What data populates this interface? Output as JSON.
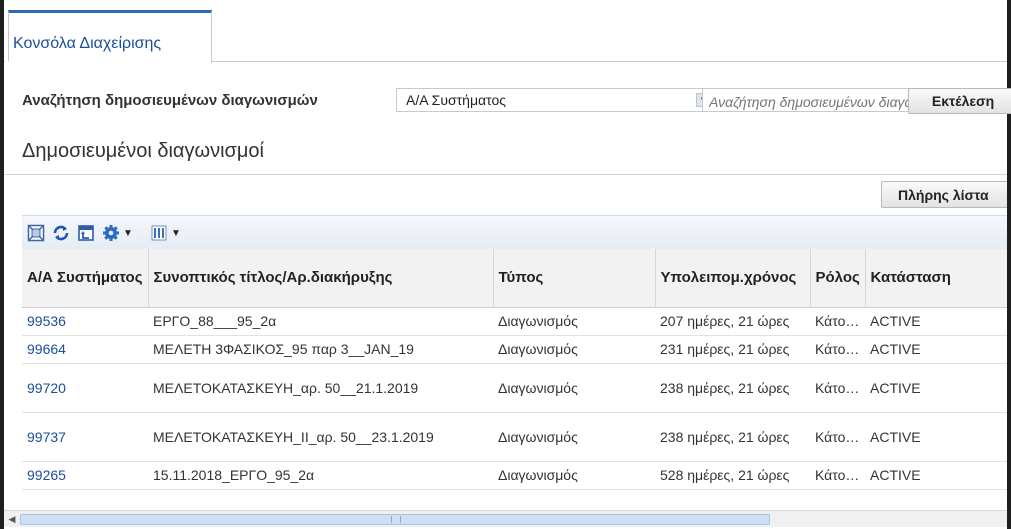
{
  "tabs": [
    {
      "label": "Κονσόλα Διαχείρισης",
      "active": true
    }
  ],
  "search": {
    "label": "Αναζήτηση δημοσιευμένων διαγωνισμών",
    "select_value": "Α/Α Συστήματος",
    "placeholder": "Αναζήτηση δημοσιευμένων διαγωνισμών",
    "execute_label": "Εκτέλεση"
  },
  "page_title": "Δημοσιευμένοι διαγωνισμοί",
  "full_list_label": "Πλήρης λίστα",
  "toolbar_icons": [
    "detach-icon",
    "refresh-icon",
    "export-icon",
    "settings-icon",
    "columns-icon"
  ],
  "table": {
    "headers": {
      "id": "Α/Α Συστήματος",
      "title": "Συνοπτικός τίτλος/Αρ.διακήρυξης",
      "type": "Τύπος",
      "remaining": "Υπολειπομ.χρόνος",
      "role": "Ρόλος",
      "status": "Κατάσταση"
    },
    "rows": [
      {
        "id": "99536",
        "title": "ΕΡΓΟ_88___95_2α",
        "type": "Διαγωνισμός",
        "remaining": "207 ημέρες, 21 ώρες",
        "role": "Κάτο…",
        "status": "ACTIVE"
      },
      {
        "id": "99664",
        "title": "ΜΕΛΕΤΗ 3ΦΑΣΙΚΟΣ_95 παρ 3__JAN_19",
        "type": "Διαγωνισμός",
        "remaining": "231 ημέρες, 21 ώρες",
        "role": "Κάτο…",
        "status": "ACTIVE"
      },
      {
        "id": "99720",
        "title": "ΜΕΛΕΤΟΚΑΤΑΣΚΕΥΗ_αρ. 50__21.1.2019",
        "type": "Διαγωνισμός",
        "remaining": "238 ημέρες, 21 ώρες",
        "role": "Κάτο…",
        "status": "ACTIVE"
      },
      {
        "id": "99737",
        "title": "ΜΕΛΕΤΟΚΑΤΑΣΚΕΥΗ_II_αρ. 50__23.1.2019",
        "type": "Διαγωνισμός",
        "remaining": "238 ημέρες, 21 ώρες",
        "role": "Κάτο…",
        "status": "ACTIVE"
      },
      {
        "id": "99265",
        "title": "15.11.2018_ΕΡΓΟ_95_2α",
        "type": "Διαγωνισμός",
        "remaining": "528 ημέρες, 21 ώρες",
        "role": "Κάτο…",
        "status": "ACTIVE"
      }
    ]
  },
  "colors": {
    "accent": "#2e6db4",
    "link": "#1a4f9c",
    "header_bg": "#f2f2f2",
    "toolbar_bg": "#e9eef5"
  }
}
